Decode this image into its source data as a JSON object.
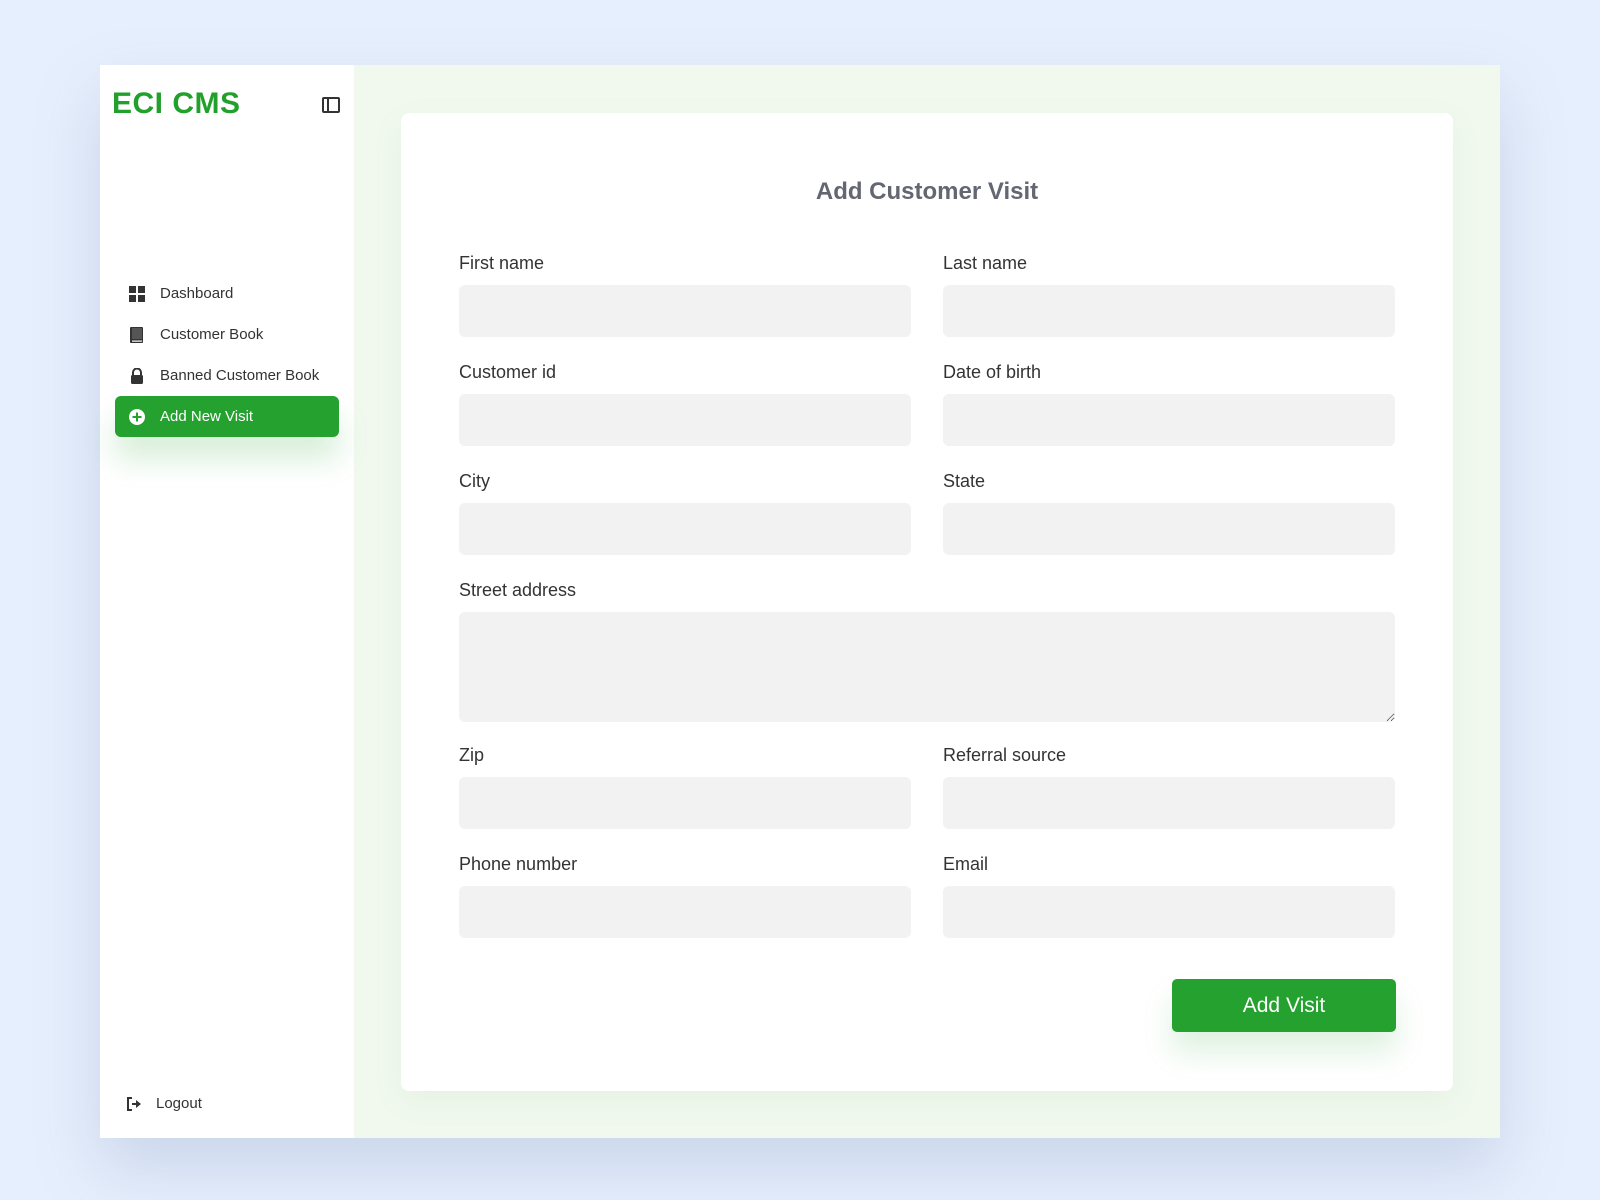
{
  "app": {
    "brand": "ECI CMS"
  },
  "sidebar": {
    "items": [
      {
        "label": "Dashboard",
        "icon": "grid-icon",
        "active": false
      },
      {
        "label": "Customer Book",
        "icon": "book-icon",
        "active": false
      },
      {
        "label": "Banned Customer Book",
        "icon": "lock-icon",
        "active": false
      },
      {
        "label": "Add New Visit",
        "icon": "plus-circle-icon",
        "active": true
      }
    ],
    "logout_label": "Logout"
  },
  "form": {
    "title": "Add Customer Visit",
    "fields": {
      "first_name": {
        "label": "First name",
        "value": ""
      },
      "last_name": {
        "label": "Last name",
        "value": ""
      },
      "customer_id": {
        "label": "Customer id",
        "value": ""
      },
      "date_of_birth": {
        "label": "Date of birth",
        "value": ""
      },
      "city": {
        "label": "City",
        "value": ""
      },
      "state": {
        "label": "State",
        "value": ""
      },
      "street_address": {
        "label": "Street address",
        "value": ""
      },
      "zip": {
        "label": "Zip",
        "value": ""
      },
      "referral_source": {
        "label": "Referral source",
        "value": ""
      },
      "phone_number": {
        "label": "Phone number",
        "value": ""
      },
      "email": {
        "label": "Email",
        "value": ""
      }
    },
    "submit_label": "Add Visit"
  },
  "colors": {
    "accent": "#24a12e",
    "brand": "#22a02c",
    "page_bg": "#e6effd",
    "content_bg": "#f1f9ee",
    "input_bg": "#f2f2f2"
  }
}
